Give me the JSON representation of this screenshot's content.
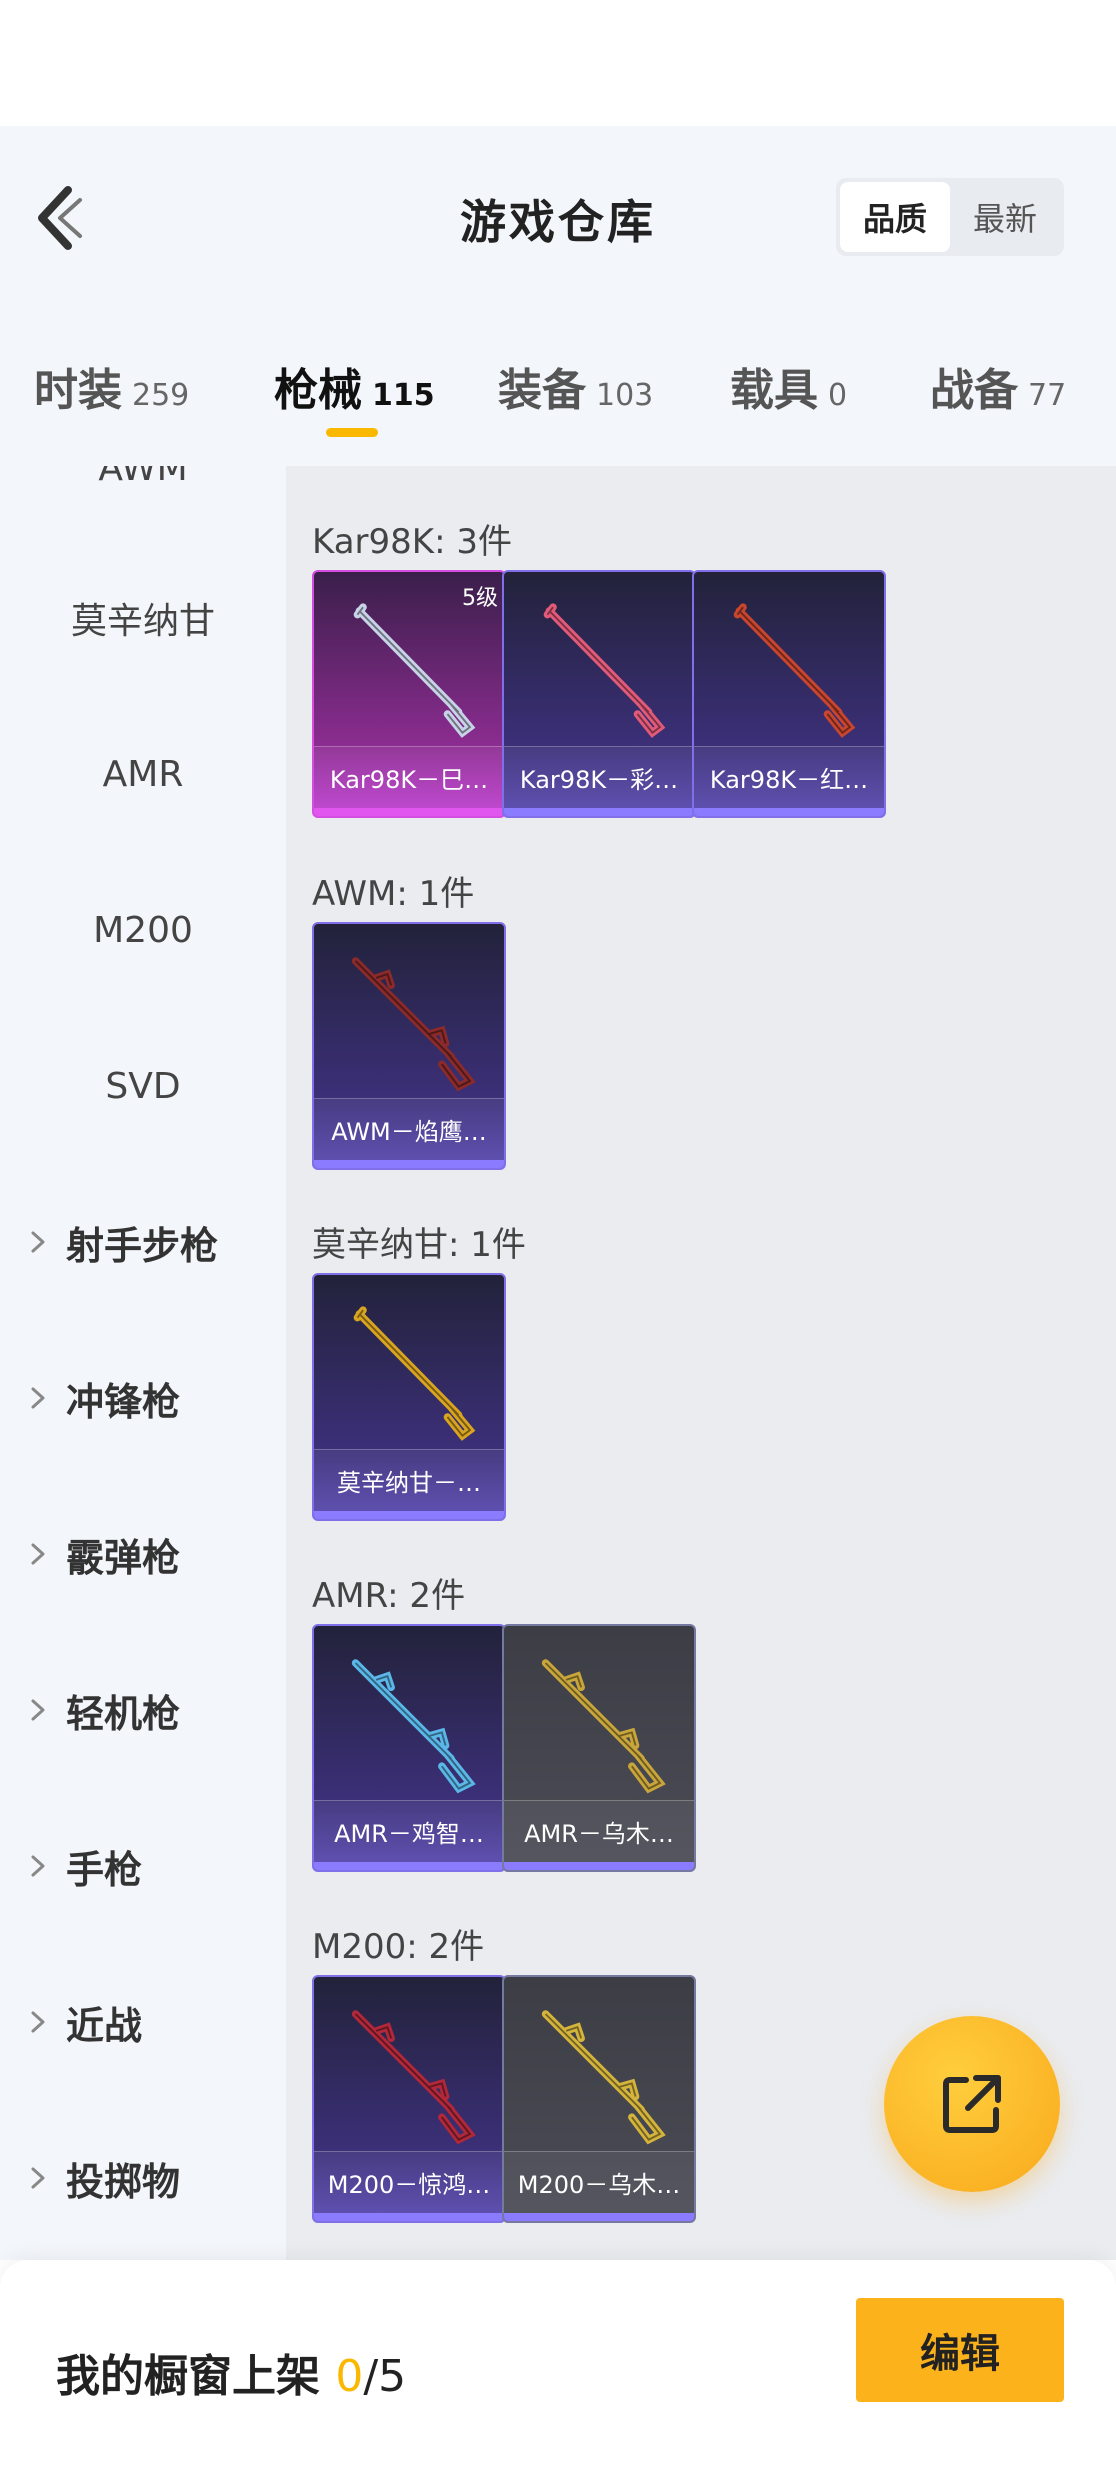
{
  "header": {
    "title": "游戏仓库",
    "sort_options": [
      "品质",
      "最新"
    ],
    "sort_selected": "品质"
  },
  "tabs": [
    {
      "label": "时装",
      "count": "259"
    },
    {
      "label": "枪械",
      "count": "115"
    },
    {
      "label": "装备",
      "count": "103"
    },
    {
      "label": "载具",
      "count": "0"
    },
    {
      "label": "战备",
      "count": "77"
    }
  ],
  "active_tab": "枪械",
  "sidebar": {
    "subitems": [
      "AWM",
      "莫辛纳甘",
      "AMR",
      "M200",
      "SVD"
    ],
    "categories": [
      "射手步枪",
      "冲锋枪",
      "霰弹枪",
      "轻机枪",
      "手枪",
      "近战",
      "投掷物"
    ]
  },
  "groups": [
    {
      "title": "Kar98K: 3件",
      "items": [
        {
          "name": "Kar98K－巳…",
          "level": "5级",
          "quality": "gold",
          "icon": "rifle-icon",
          "color": "#c9d3e8"
        },
        {
          "name": "Kar98K－彩…",
          "level": "",
          "quality": "purple",
          "icon": "rifle-icon",
          "color": "#e25a7a"
        },
        {
          "name": "Kar98K－红…",
          "level": "",
          "quality": "purple",
          "icon": "rifle-icon",
          "color": "#c8452f"
        }
      ]
    },
    {
      "title": "AWM: 1件",
      "items": [
        {
          "name": "AWM－焰鹰…",
          "level": "",
          "quality": "purple",
          "icon": "sniper-rifle-icon",
          "color": "#8a2a2a"
        }
      ]
    },
    {
      "title": "莫辛纳甘: 1件",
      "items": [
        {
          "name": "莫辛纳甘－…",
          "level": "",
          "quality": "purple",
          "icon": "rifle-icon",
          "color": "#d9a520"
        }
      ]
    },
    {
      "title": "AMR: 2件",
      "items": [
        {
          "name": "AMR－鸡智…",
          "level": "",
          "quality": "purple",
          "icon": "sniper-rifle-icon",
          "color": "#5ab7e8"
        },
        {
          "name": "AMR－乌木…",
          "level": "",
          "quality": "gray",
          "icon": "sniper-rifle-icon",
          "color": "#c9a63b"
        }
      ]
    },
    {
      "title": "M200: 2件",
      "items": [
        {
          "name": "M200－惊鸿…",
          "level": "",
          "quality": "purple",
          "icon": "sniper-rifle-icon",
          "color": "#b0283a"
        },
        {
          "name": "M200－乌木…",
          "level": "",
          "quality": "gray",
          "icon": "sniper-rifle-icon",
          "color": "#d4b43c"
        }
      ]
    }
  ],
  "showcase": {
    "label": "我的橱窗上架 ",
    "current": "0",
    "separator": "/",
    "total": "5",
    "edit_label": "编辑"
  },
  "colors": {
    "accent": "#fbb800",
    "tab_underline": "#fbb800",
    "purple_border": "#7f6fe8",
    "gold_border": "#d54ee2"
  }
}
